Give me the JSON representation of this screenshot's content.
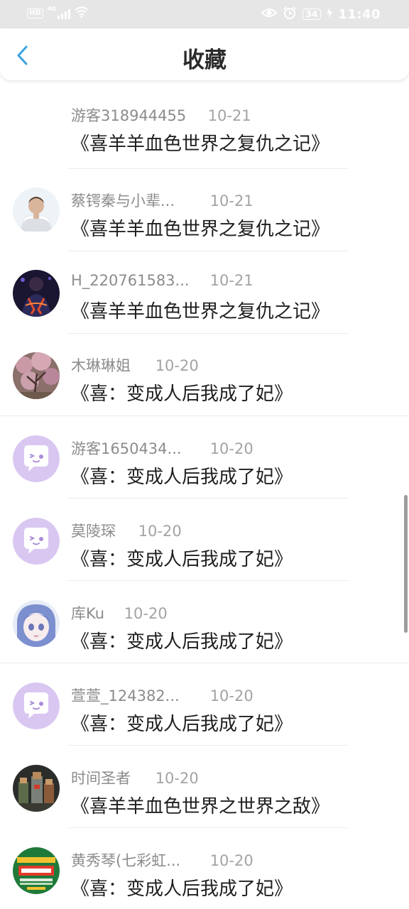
{
  "status_bar": {
    "hd": "HD",
    "network": "4G",
    "battery": "34",
    "time": "11:40"
  },
  "header": {
    "title": "收藏"
  },
  "items": [
    {
      "user": "游客318944455",
      "date": "10-21",
      "book": "《喜羊羊血色世界之复仇之记》",
      "avatar": "none"
    },
    {
      "user": "蔡锷秦与小辈...",
      "date": "10-21",
      "book": "《喜羊羊血色世界之复仇之记》",
      "avatar": "photo-person"
    },
    {
      "user": "H_220761583...",
      "date": "10-21",
      "book": "《喜羊羊血色世界之复仇之记》",
      "avatar": "photo-dark"
    },
    {
      "user": "木琳琳姐",
      "date": "10-20",
      "book": "《喜：变成人后我成了妃》",
      "avatar": "photo-blossom"
    },
    {
      "user": "游客1650434...",
      "date": "10-20",
      "book": "《喜：变成人后我成了妃》",
      "avatar": "default-chat"
    },
    {
      "user": "莫陵琛",
      "date": "10-20",
      "book": "《喜：变成人后我成了妃》",
      "avatar": "default-chat"
    },
    {
      "user": "库Ku",
      "date": "10-20",
      "book": "《喜：变成人后我成了妃》",
      "avatar": "anime-girl"
    },
    {
      "user": "萱萱_124382...",
      "date": "10-20",
      "book": "《喜：变成人后我成了妃》",
      "avatar": "default-chat"
    },
    {
      "user": "时间圣者",
      "date": "10-20",
      "book": "《喜羊羊血色世界之世界之敌》",
      "avatar": "photo-game"
    },
    {
      "user": "黄秀琴(七彩虹...",
      "date": "10-20",
      "book": "《喜：变成人后我成了妃》",
      "avatar": "photo-poster"
    }
  ],
  "colors": {
    "accent": "#3aa3e0",
    "status_bar_bg": "#e6e6e6",
    "default_avatar": "#d9c7f2"
  }
}
